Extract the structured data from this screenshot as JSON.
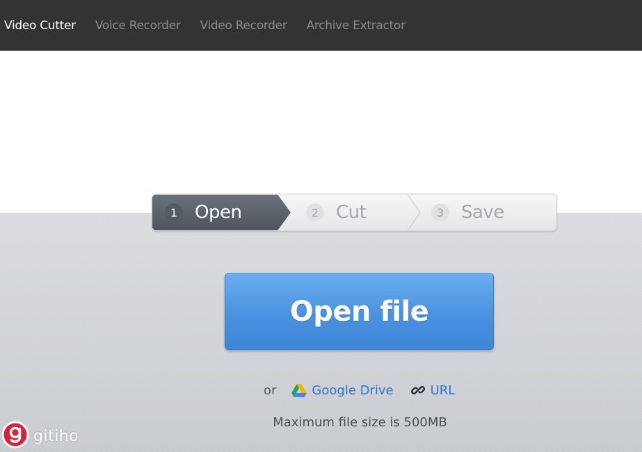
{
  "nav": {
    "items": [
      {
        "label": "Video Cutter",
        "active": true
      },
      {
        "label": "Voice Recorder",
        "active": false
      },
      {
        "label": "Video Recorder",
        "active": false
      },
      {
        "label": "Archive Extractor",
        "active": false
      }
    ]
  },
  "steps": [
    {
      "number": "1",
      "label": "Open",
      "active": true
    },
    {
      "number": "2",
      "label": "Cut",
      "active": false
    },
    {
      "number": "3",
      "label": "Save",
      "active": false
    }
  ],
  "open_button": {
    "label": "Open file"
  },
  "alt_sources": {
    "or_label": "or",
    "google_drive_label": "Google Drive",
    "url_label": "URL"
  },
  "limits": {
    "max_size_text": "Maximum file size is 500MB"
  },
  "watermark": {
    "text": "gitiho"
  },
  "colors": {
    "nav_bg": "#333333",
    "accent_blue": "#4a92e0",
    "link_blue": "#2f78c8",
    "step_active": "#5a6068",
    "watermark_red": "#d6243a"
  }
}
